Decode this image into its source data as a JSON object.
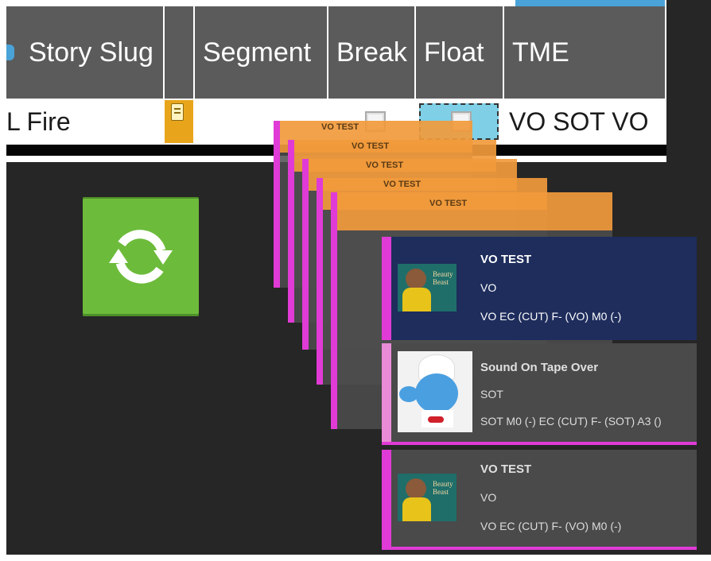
{
  "table": {
    "headers": [
      "Story Slug",
      "",
      "Segment",
      "Break",
      "Float",
      "TME"
    ],
    "row": {
      "story_slug": "L Fire",
      "tme": "VO SOT VO"
    }
  },
  "refresh_button": {
    "icon": "refresh-icon",
    "color": "#6dbb3b"
  },
  "ghost_cards": [
    {
      "label": "VO TEST"
    },
    {
      "label": "VO TEST"
    },
    {
      "label": "VO TEST"
    },
    {
      "label": "VO TEST"
    },
    {
      "label": "VO TEST"
    }
  ],
  "cards": [
    {
      "title": "VO TEST",
      "type": "VO",
      "detail": "VO EC (CUT) F- (VO) M0 (-)",
      "thumb": "movie-poster-thumbnail",
      "thumb_text": "Beauty Beast",
      "selected": true
    },
    {
      "title": "Sound On Tape Over",
      "type": "SOT",
      "detail": "SOT M0 (-) EC (CUT) F- (SOT) A3 ()",
      "thumb": "smurf-thumbnail",
      "selected": false
    },
    {
      "title": "VO TEST",
      "type": "VO",
      "detail": "VO EC (CUT) F- (VO) M0 (-)",
      "thumb": "movie-poster-thumbnail",
      "thumb_text": "Beauty Beast",
      "selected": false
    }
  ],
  "colors": {
    "header_bg": "#5b5b5b",
    "card_stripe": "#e03bd6",
    "selected_card": "#1e2d5c",
    "card_bg": "#4a4a4a",
    "ghost_orange": "#f19a3c",
    "float_highlight": "#7fd0e6",
    "note_icon_bg": "#e8a51b"
  }
}
